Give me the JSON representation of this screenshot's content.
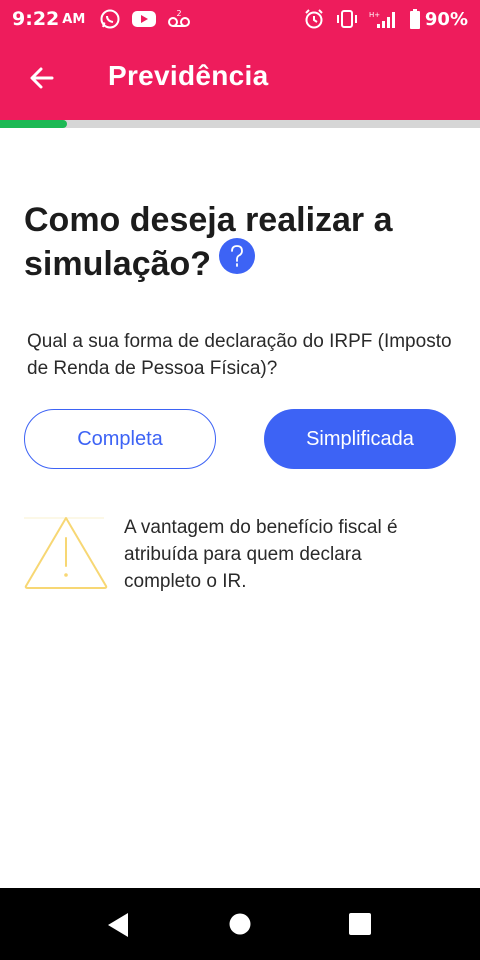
{
  "status_bar": {
    "time": "9:22",
    "ampm": "AM",
    "battery": "90%",
    "icons": [
      "whatsapp-icon",
      "youtube-icon",
      "voicemail-icon",
      "alarm-icon",
      "vibrate-icon",
      "signal-icon",
      "battery-icon"
    ]
  },
  "app_bar": {
    "title": "Previdência"
  },
  "progress": {
    "value": 0.14,
    "colors": {
      "fill": "#1db954",
      "track": "#d6d6d6"
    }
  },
  "main": {
    "heading": "Como deseja realizar a simulação?",
    "question": "Qual a sua forma de declaração do IRPF (Imposto de Renda de Pessoa Física)?",
    "options": {
      "complete_label": "Completa",
      "simplified_label": "Simplificada"
    },
    "warning": "A vantagem do benefício fiscal é atribuída para quem declara completo o IR."
  },
  "colors": {
    "brand": "#ee1c5c",
    "accent": "#3d63f5",
    "warning": "#f7d774"
  }
}
